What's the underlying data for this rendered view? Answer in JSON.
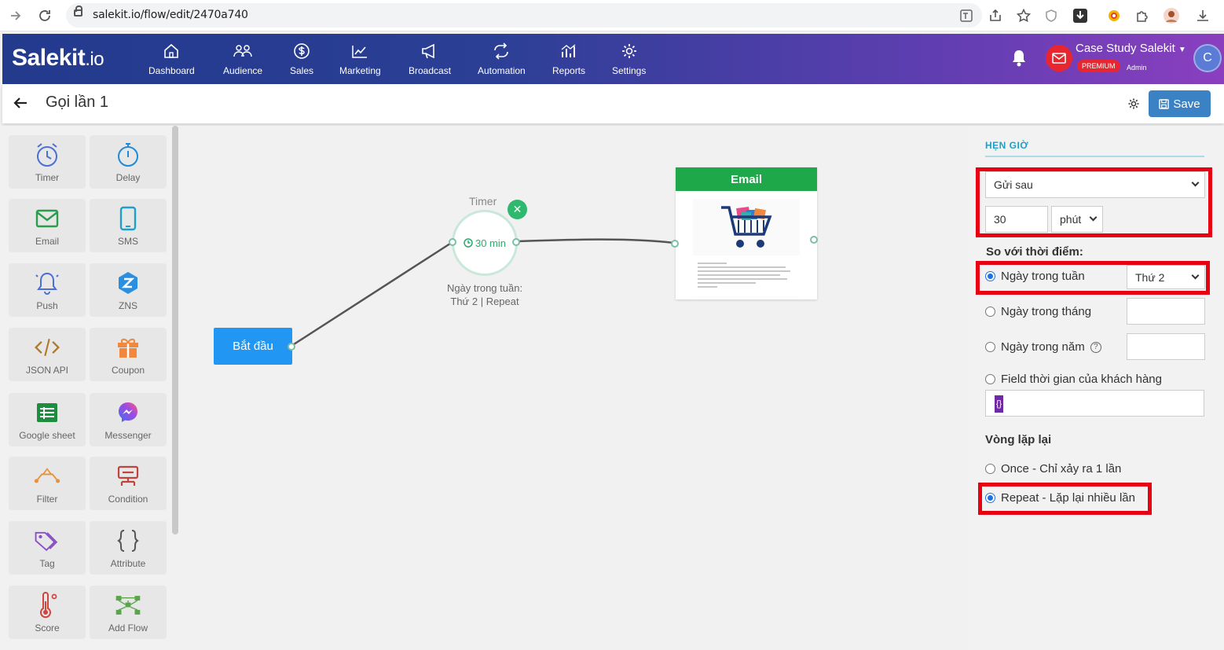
{
  "browser": {
    "url": "salekit.io/flow/edit/2470a740"
  },
  "header": {
    "logo_main": "Salekit",
    "logo_suffix": ".io",
    "nav": [
      {
        "label": "Dashboard",
        "icon": "home-icon"
      },
      {
        "label": "Audience",
        "icon": "users-icon"
      },
      {
        "label": "Sales",
        "icon": "dollar-icon"
      },
      {
        "label": "Marketing",
        "icon": "chart-line-icon"
      },
      {
        "label": "Broadcast",
        "icon": "megaphone-icon"
      },
      {
        "label": "Automation",
        "icon": "repeat-icon"
      },
      {
        "label": "Reports",
        "icon": "bar-chart-icon"
      },
      {
        "label": "Settings",
        "icon": "gear-icon"
      }
    ],
    "account_name": "Case Study Salekit",
    "premium_badge": "PREMIUM",
    "role": "Admin",
    "avatar_letter": "C"
  },
  "subheader": {
    "title": "Gọi lần 1",
    "save_label": "Save"
  },
  "palette": [
    {
      "label": "Timer",
      "icon": "alarm-clock-icon"
    },
    {
      "label": "Delay",
      "icon": "stopwatch-icon"
    },
    {
      "label": "Email",
      "icon": "envelope-icon"
    },
    {
      "label": "SMS",
      "icon": "phone-icon"
    },
    {
      "label": "Push",
      "icon": "bell-ring-icon"
    },
    {
      "label": "ZNS",
      "icon": "zalo-icon"
    },
    {
      "label": "JSON API",
      "icon": "code-icon"
    },
    {
      "label": "Coupon",
      "icon": "gift-icon"
    },
    {
      "label": "Google sheet",
      "icon": "sheet-icon"
    },
    {
      "label": "Messenger",
      "icon": "messenger-icon"
    },
    {
      "label": "Filter",
      "icon": "filter-icon"
    },
    {
      "label": "Condition",
      "icon": "condition-icon"
    },
    {
      "label": "Tag",
      "icon": "tag-icon"
    },
    {
      "label": "Attribute",
      "icon": "braces-icon"
    },
    {
      "label": "Score",
      "icon": "thermometer-icon"
    },
    {
      "label": "Add Flow",
      "icon": "flow-icon"
    }
  ],
  "canvas": {
    "start_label": "Bắt đầu",
    "timer_title": "Timer",
    "timer_value": "30 min",
    "timer_sub_line1": "Ngày trong tuần:",
    "timer_sub_line2": "Thứ 2 | Repeat",
    "email_title": "Email"
  },
  "panel": {
    "section_title": "HẸN GIỜ",
    "mode_select": "Gửi sau",
    "amount_value": "30",
    "unit_select": "phút",
    "compare_label": "So với thời điểm:",
    "opt_week": "Ngày trong tuần",
    "week_select": "Thứ 2",
    "opt_month": "Ngày trong tháng",
    "opt_year": "Ngày trong năm",
    "help_glyph": "?",
    "opt_field": "Field thời gian của khách hàng",
    "field_chip": "{}",
    "repeat_label": "Vòng lặp lại",
    "opt_once": "Once - Chỉ xảy ra 1 lần",
    "opt_repeat": "Repeat - Lặp lại nhiều lần"
  },
  "colors": {
    "header_start": "#233a8d",
    "header_end": "#8a3fbf",
    "primary": "#2196f3",
    "email_green": "#1ea84a",
    "highlight_red": "#e60012"
  }
}
